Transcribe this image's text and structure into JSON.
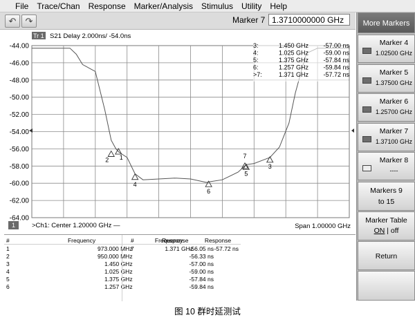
{
  "menu": [
    "File",
    "Trace/Chan",
    "Response",
    "Marker/Analysis",
    "Stimulus",
    "Utility",
    "Help"
  ],
  "toolbar": {
    "active_marker_label": "Marker 7",
    "active_marker_value": "1.3710000000 GHz"
  },
  "trace": {
    "tag": "Tr 1",
    "desc": "S21 Delay 2.000ns/  -54.0ns",
    "channel_num": "1",
    "start_text": ">Ch1: Center  1.20000 GHz —",
    "span_text": "Span  1.00000 GHz"
  },
  "chart_data": {
    "type": "line",
    "ylim": [
      -64.0,
      -44.0
    ],
    "yticks": [
      "-44.00",
      "-46.00",
      "-48.00",
      "-50.00",
      "-52.00",
      "-54.00",
      "-56.00",
      "-58.00",
      "-60.00",
      "-62.00",
      "-64.00"
    ],
    "x_ghz_range": [
      0.7,
      1.7
    ],
    "grid": true,
    "series": [
      {
        "values_x": [
          0.7,
          0.82,
          0.84,
          0.86,
          0.9,
          0.93,
          0.95,
          0.965,
          0.975,
          1.0,
          1.025,
          1.05,
          1.1,
          1.15,
          1.2,
          1.25,
          1.257,
          1.3,
          1.35,
          1.375,
          1.4,
          1.45,
          1.48,
          1.51,
          1.53,
          1.55,
          1.565,
          1.6,
          1.7
        ],
        "values_y": [
          -44.3,
          -44.3,
          -45.0,
          -46.2,
          -47.0,
          -51.5,
          -55.0,
          -56.0,
          -56.4,
          -57.0,
          -58.9,
          -59.6,
          -59.5,
          -59.4,
          -59.5,
          -59.9,
          -59.84,
          -59.6,
          -58.7,
          -57.84,
          -57.7,
          -57.0,
          -55.8,
          -53.0,
          -49.5,
          -46.8,
          -44.9,
          -44.3,
          -44.3
        ]
      }
    ],
    "markers": [
      {
        "num": "1",
        "x": 0.973,
        "y": -56.05
      },
      {
        "num": "2",
        "x": 0.95,
        "y": -56.33
      },
      {
        "num": "3",
        "x": 1.45,
        "y": -57.0
      },
      {
        "num": "4",
        "x": 1.025,
        "y": -59.0
      },
      {
        "num": "5",
        "x": 1.375,
        "y": -57.84
      },
      {
        "num": "6",
        "x": 1.257,
        "y": -59.84
      },
      {
        "num": "7",
        "x": 1.371,
        "y": -57.72
      }
    ]
  },
  "overlay_readouts": [
    {
      "num": "3:",
      "freq": "1.450 GHz",
      "resp": "-57.00 ns"
    },
    {
      "num": "4:",
      "freq": "1.025 GHz",
      "resp": "-59.00 ns"
    },
    {
      "num": "5:",
      "freq": "1.375 GHz",
      "resp": "-57.84 ns"
    },
    {
      "num": "6:",
      "freq": "1.257 GHz",
      "resp": "-59.84 ns"
    },
    {
      "num": ">7:",
      "freq": "1.371 GHz",
      "resp": "-57.72 ns"
    }
  ],
  "marker_table": {
    "headers": [
      "#",
      "Frequency",
      "Response"
    ],
    "rows": [
      [
        "1",
        "973.000 MHz",
        "-56.05 ns"
      ],
      [
        "2",
        "950.000 MHz",
        "-56.33 ns"
      ],
      [
        "3",
        "1.450 GHz",
        "-57.00 ns"
      ],
      [
        "4",
        "1.025 GHz",
        "-59.00 ns"
      ],
      [
        "5",
        "1.375 GHz",
        "-57.84 ns"
      ],
      [
        "6",
        "1.257 GHz",
        "-59.84 ns"
      ]
    ],
    "rows2": [
      [
        "7",
        "1.371 GHz",
        "-57.72 ns"
      ]
    ]
  },
  "softkeys": {
    "title": "More Markers",
    "markers": [
      {
        "label": "Marker 4",
        "value": "1.02500 GHz",
        "active": true
      },
      {
        "label": "Marker 5",
        "value": "1.37500 GHz",
        "active": true
      },
      {
        "label": "Marker 6",
        "value": "1.25700 GHz",
        "active": true
      },
      {
        "label": "Marker 7",
        "value": "1.37100 GHz",
        "active": true
      },
      {
        "label": "Marker 8",
        "value": "----",
        "active": false
      }
    ],
    "markers_9_15_line1": "Markers 9",
    "markers_9_15_line2": "to 15",
    "marker_table_title": "Marker Table",
    "marker_table_on": "ON",
    "marker_table_sep": " | ",
    "marker_table_off": "off",
    "return_label": "Return"
  },
  "caption": "图 10    群时延测试"
}
